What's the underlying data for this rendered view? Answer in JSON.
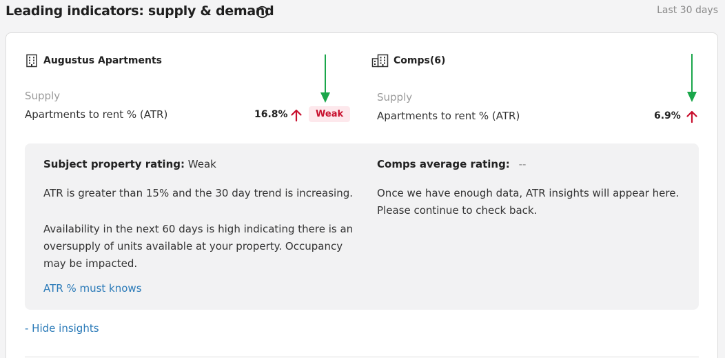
{
  "header": {
    "title": "Leading indicators: supply & demand",
    "period": "Last 30 days"
  },
  "left": {
    "property_name": "Augustus Apartments",
    "supply_label": "Supply",
    "metric_label": "Apartments to rent % (ATR)",
    "metric_value": "16.8%",
    "trend": "up",
    "badge": "Weak"
  },
  "right": {
    "property_name": "Comps(6)",
    "supply_label": "Supply",
    "metric_label": "Apartments to rent % (ATR)",
    "metric_value": "6.9%",
    "trend": "up"
  },
  "insights": {
    "subject_rating_label": "Subject property rating:",
    "subject_rating_value": "Weak",
    "subject_text_1": "ATR is greater than 15% and the 30 day trend is increasing.",
    "subject_text_2": "Availability in the next 60 days is high indicating there is an oversupply of units available at your property. Occupancy may be impacted.",
    "subject_link": "ATR % must knows",
    "comps_rating_label": "Comps average rating:",
    "comps_rating_value": "--",
    "comps_text": "Once we have enough data, ATR insights will appear here. Please continue to check back."
  },
  "footer": {
    "hide_insights": "- Hide insights"
  },
  "colors": {
    "trend_up": "#c8102e",
    "annotation_arrow": "#1aa64a",
    "link": "#2a7ab8"
  },
  "icons": [
    "info-icon",
    "building-icon",
    "buildings-icon",
    "arrow-up-icon",
    "annotation-arrow-down-icon"
  ]
}
